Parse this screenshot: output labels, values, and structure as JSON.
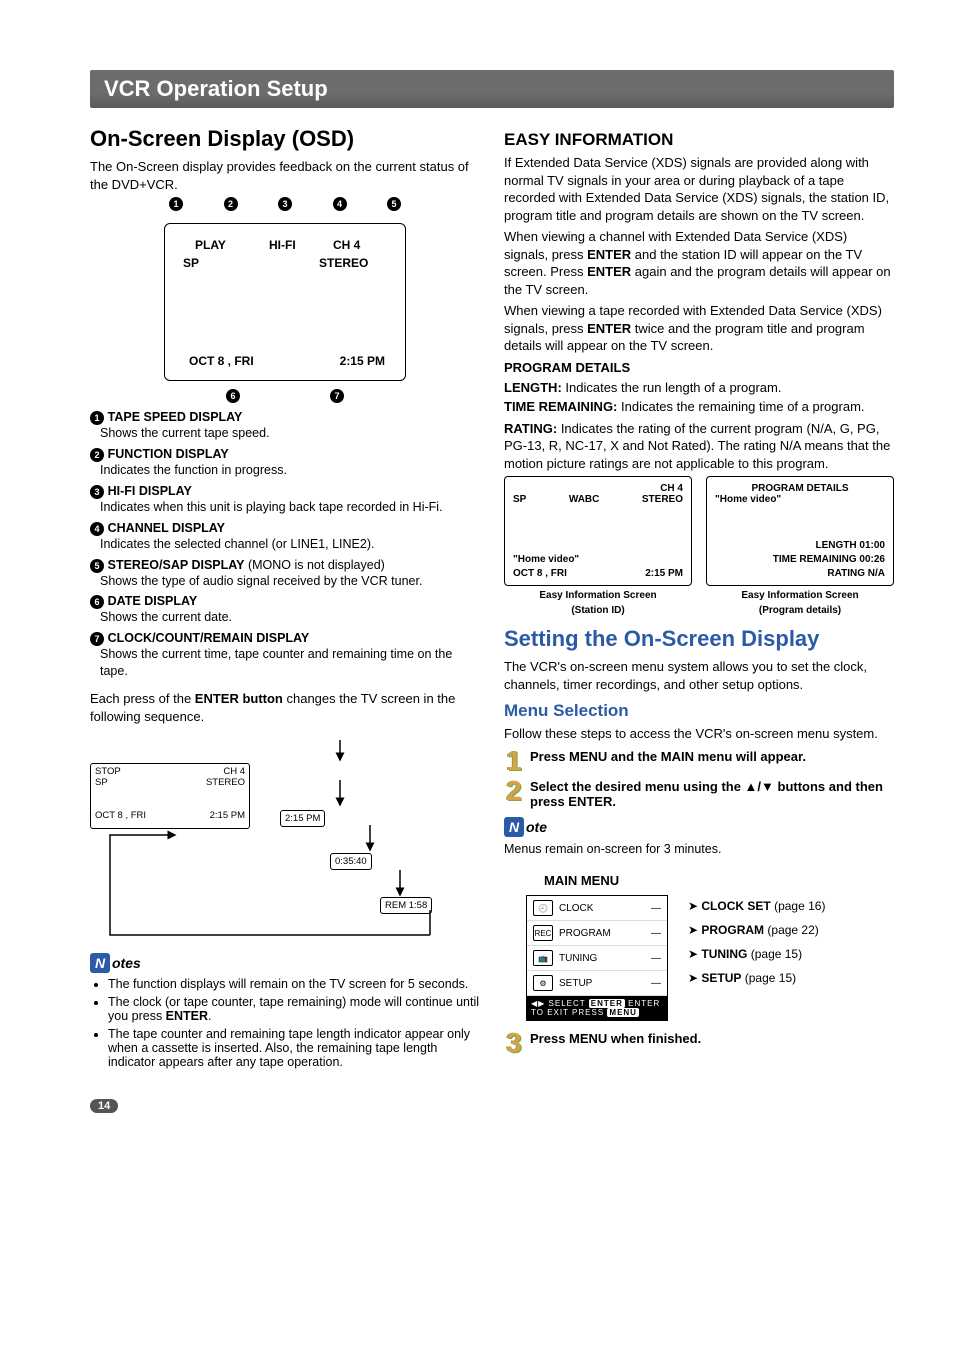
{
  "titleBar": "VCR Operation Setup",
  "left": {
    "h2": "On-Screen Display (OSD)",
    "intro": "The On-Screen display provides feedback on the current status of the DVD+VCR.",
    "osd": {
      "play": "PLAY",
      "hifi": "HI-FI",
      "ch": "CH  4",
      "sp": "SP",
      "stereo": "STEREO",
      "date": "OCT  8 ,  FRI",
      "time": "2:15 PM"
    },
    "defs": [
      {
        "num": "1",
        "term": "TAPE SPEED DISPLAY",
        "body": "Shows the current tape speed."
      },
      {
        "num": "2",
        "term": "FUNCTION DISPLAY",
        "body": "Indicates the function in progress."
      },
      {
        "num": "3",
        "term": "HI-FI DISPLAY",
        "body": "Indicates when this unit is playing back tape recorded in Hi-Fi."
      },
      {
        "num": "4",
        "term": "CHANNEL DISPLAY",
        "body": "Indicates the selected channel (or LINE1, LINE2)."
      },
      {
        "num": "5",
        "term": "STEREO/SAP DISPLAY",
        "termSuffix": " (MONO is not displayed)",
        "body": "Shows the type of audio signal received by the VCR tuner."
      },
      {
        "num": "6",
        "term": "DATE DISPLAY",
        "body": "Shows the current date."
      },
      {
        "num": "7",
        "term": "CLOCK/COUNT/REMAIN DISPLAY",
        "body": "Shows the current time, tape counter and remaining time on the tape."
      }
    ],
    "enterPara1": "Each press of the ",
    "enterBold": "ENTER button",
    "enterPara2": " changes the TV screen in the following sequence.",
    "seq": {
      "stop": "STOP",
      "sp": "SP",
      "ch": "CH  4",
      "stereo": "STEREO",
      "date": "OCT  8 , FRI",
      "t1": "2:15 PM",
      "t2": "2:15 PM",
      "t3": "0:35:40",
      "t4": "REM 1:58"
    },
    "notesHead": "otes",
    "notes": [
      "The function displays will remain on the TV screen for 5 seconds.",
      "The clock (or tape counter, tape remaining) mode will continue until you press ENTER.",
      "The tape counter and remaining tape length indicator appear only when a cassette is inserted. Also, the remaining tape length indicator appears after any tape operation."
    ]
  },
  "right": {
    "h3Easy": "EASY INFORMATION",
    "easyPara": "If Extended Data Service (XDS) signals are provided along with normal TV signals in your area or during playback of a tape recorded with Extended Data Service (XDS) signals, the station ID, program title and program details are shown on the TV screen.",
    "easyPara2a": "When viewing a channel with Extended Data Service (XDS) signals, press ",
    "easyPara2b": " and the station ID will appear on the TV screen. Press ",
    "easyPara2c": " again and the program details will appear on the TV screen.",
    "easyPara3a": "When viewing a tape recorded with Extended  Data Service (XDS) signals, press ",
    "easyPara3b": " twice and the program title and program details will appear on the TV screen.",
    "enter": "ENTER",
    "progDetailsHead": "PROGRAM DETAILS",
    "lengthLabel": "LENGTH:",
    "lengthText": " Indicates the run length of a program.",
    "timeRemLabel": "TIME REMAINING:",
    "timeRemText": " Indicates the remaining time of a program.",
    "ratingLabel": "RATING:",
    "ratingText": " Indicates the rating of the current program (N/A, G, PG, PG-13, R, NC-17, X and Not Rated). The rating N/A means that the motion picture ratings are not applicable to this program.",
    "xdsLeft": {
      "sp": "SP",
      "ch": "CH  4",
      "wabc": "WABC",
      "stereo": "STEREO",
      "hv": "\"Home video\"",
      "date": "OCT  8 , FRI",
      "time": "2:15 PM",
      "cap1": "Easy Information Screen",
      "cap2": "(Station ID)"
    },
    "xdsRight": {
      "title": "PROGRAM DETAILS",
      "hv": "\"Home video\"",
      "len": "LENGTH  01:00",
      "tr": "TIME REMAINING  00:26",
      "rat": "RATING  N/A",
      "cap1": "Easy Information Screen",
      "cap2": "(Program details)"
    },
    "h2Setting": "Setting the On-Screen Display",
    "settingIntro": "The VCR's on-screen menu system allows you to set the clock, channels, timer recordings, and other setup options.",
    "h3MenuSel": "Menu Selection",
    "menuSelIntro": "Follow these steps to access the VCR's on-screen menu system.",
    "step1": "Press MENU and the MAIN menu will appear.",
    "step2": "Select the desired menu using the ▲/▼ buttons and then press ENTER.",
    "noteHead": "ote",
    "noteBody": "Menus remain on-screen for 3 minutes.",
    "mainMenuLabel": "MAIN MENU",
    "menuItems": {
      "clock": "CLOCK",
      "program": "PROGRAM",
      "tuning": "TUNING",
      "setup": "SETUP"
    },
    "menuFoot1": "SELECT",
    "menuFoot1b": "ENTER",
    "menuFoot1c": "ENTER",
    "menuFoot2a": "TO  EXIT PRESS",
    "menuFoot2b": "MENU",
    "menuTargets": {
      "clock": "CLOCK SET",
      "clockPage": " (page 16)",
      "program": "PROGRAM",
      "programPage": " (page 22)",
      "tuning": "TUNING",
      "tuningPage": " (page 15)",
      "setup": "SETUP",
      "setupPage": " (page 15)"
    },
    "step3": "Press MENU when finished."
  },
  "pageNum": "14"
}
